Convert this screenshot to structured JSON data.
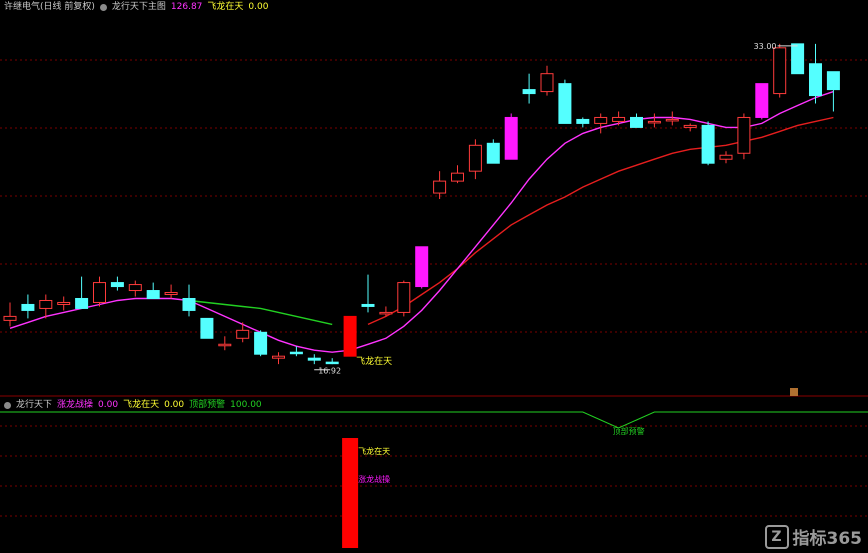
{
  "header": {
    "stock": "许继电气(日线 前复权)",
    "main_name": "龙行天下主图",
    "main_value": "126.87",
    "feilong_label": "飞龙在天",
    "feilong_value": "0.00"
  },
  "indicator_header": {
    "name": "龙行天下",
    "zhanglong_label": "涨龙战操",
    "zhanglong_value": "0.00",
    "feilong_label": "飞龙在天",
    "feilong_value": "0.00",
    "dingbu_label": "顶部预警",
    "dingbu_value": "100.00"
  },
  "annotations": {
    "high": "33.00",
    "low": "16.92",
    "feilong_main": "飞龙在天",
    "feilong_sub": "飞龙在天",
    "zhanglong_sub": "涨龙战操",
    "dingbu_sub": "顶部预警"
  },
  "watermark": {
    "logo": "Z",
    "text": "指标365"
  },
  "colors": {
    "up": "#ff3b3b",
    "up_strong": "#ff19ff",
    "down": "#54ffff",
    "ma_fast": "#ff33ff",
    "ma_slow": "#e61e1e",
    "ma_mid": "#22d022",
    "signal": "#ff0000",
    "grid": "#7a0000",
    "label": "#ffff33"
  },
  "chart_data": {
    "type": "candlestick",
    "price_range": [
      15.5,
      34.5
    ],
    "candles": [
      {
        "o": 19.3,
        "h": 20.0,
        "l": 18.8,
        "c": 19.1,
        "t": "up"
      },
      {
        "o": 19.6,
        "h": 20.4,
        "l": 19.2,
        "c": 19.9,
        "t": "down"
      },
      {
        "o": 19.7,
        "h": 20.4,
        "l": 19.2,
        "c": 20.1,
        "t": "up"
      },
      {
        "o": 19.9,
        "h": 20.3,
        "l": 19.6,
        "c": 20.0,
        "t": "up"
      },
      {
        "o": 20.2,
        "h": 21.3,
        "l": 19.7,
        "c": 19.7,
        "t": "down"
      },
      {
        "o": 20.0,
        "h": 21.3,
        "l": 19.8,
        "c": 21.0,
        "t": "up"
      },
      {
        "o": 21.0,
        "h": 21.3,
        "l": 20.6,
        "c": 20.8,
        "t": "down"
      },
      {
        "o": 20.6,
        "h": 21.1,
        "l": 20.3,
        "c": 20.9,
        "t": "up"
      },
      {
        "o": 20.6,
        "h": 21.0,
        "l": 20.2,
        "c": 20.2,
        "t": "down"
      },
      {
        "o": 20.4,
        "h": 20.9,
        "l": 20.2,
        "c": 20.5,
        "t": "up"
      },
      {
        "o": 20.2,
        "h": 20.9,
        "l": 19.3,
        "c": 19.6,
        "t": "down"
      },
      {
        "o": 19.2,
        "h": 19.2,
        "l": 18.2,
        "c": 18.2,
        "t": "down"
      },
      {
        "o": 17.9,
        "h": 18.3,
        "l": 17.6,
        "c": 17.9,
        "t": "up"
      },
      {
        "o": 18.2,
        "h": 19.0,
        "l": 18.0,
        "c": 18.6,
        "t": "up"
      },
      {
        "o": 18.5,
        "h": 18.6,
        "l": 17.3,
        "c": 17.4,
        "t": "down"
      },
      {
        "o": 17.3,
        "h": 17.5,
        "l": 16.9,
        "c": 17.2,
        "t": "up"
      },
      {
        "o": 17.5,
        "h": 17.8,
        "l": 17.3,
        "c": 17.5,
        "t": "down"
      },
      {
        "o": 17.2,
        "h": 17.4,
        "l": 16.9,
        "c": 17.1,
        "t": "down"
      },
      {
        "o": 17.0,
        "h": 17.2,
        "l": 16.9,
        "c": 17.0,
        "t": "down"
      },
      {
        "o": 17.3,
        "h": 19.3,
        "l": 17.3,
        "c": 19.3,
        "t": "signal"
      },
      {
        "o": 19.9,
        "h": 21.4,
        "l": 19.5,
        "c": 19.8,
        "t": "down"
      },
      {
        "o": 19.5,
        "h": 19.8,
        "l": 19.3,
        "c": 19.5,
        "t": "up"
      },
      {
        "o": 19.5,
        "h": 21.1,
        "l": 19.3,
        "c": 21.0,
        "t": "up"
      },
      {
        "o": 20.8,
        "h": 22.8,
        "l": 20.7,
        "c": 22.8,
        "t": "up_strong"
      },
      {
        "o": 25.5,
        "h": 26.6,
        "l": 25.2,
        "c": 26.1,
        "t": "up"
      },
      {
        "o": 26.1,
        "h": 26.9,
        "l": 26.0,
        "c": 26.5,
        "t": "up"
      },
      {
        "o": 26.6,
        "h": 28.2,
        "l": 26.2,
        "c": 27.9,
        "t": "up"
      },
      {
        "o": 28.0,
        "h": 28.2,
        "l": 27.0,
        "c": 27.0,
        "t": "down"
      },
      {
        "o": 27.2,
        "h": 29.5,
        "l": 27.2,
        "c": 29.3,
        "t": "up_strong"
      },
      {
        "o": 30.7,
        "h": 31.5,
        "l": 30.0,
        "c": 30.5,
        "t": "down"
      },
      {
        "o": 30.6,
        "h": 31.9,
        "l": 30.4,
        "c": 31.5,
        "t": "up"
      },
      {
        "o": 31.0,
        "h": 31.2,
        "l": 29.0,
        "c": 29.0,
        "t": "down"
      },
      {
        "o": 29.2,
        "h": 29.3,
        "l": 28.8,
        "c": 29.0,
        "t": "down"
      },
      {
        "o": 29.0,
        "h": 29.5,
        "l": 28.5,
        "c": 29.3,
        "t": "up"
      },
      {
        "o": 29.3,
        "h": 29.6,
        "l": 28.9,
        "c": 29.1,
        "t": "up"
      },
      {
        "o": 29.3,
        "h": 29.5,
        "l": 28.8,
        "c": 28.8,
        "t": "down"
      },
      {
        "o": 29.1,
        "h": 29.5,
        "l": 28.8,
        "c": 29.1,
        "t": "up"
      },
      {
        "o": 29.2,
        "h": 29.6,
        "l": 28.9,
        "c": 29.2,
        "t": "up"
      },
      {
        "o": 28.8,
        "h": 29.0,
        "l": 28.6,
        "c": 28.9,
        "t": "up"
      },
      {
        "o": 28.9,
        "h": 29.1,
        "l": 26.9,
        "c": 27.0,
        "t": "down"
      },
      {
        "o": 27.2,
        "h": 27.6,
        "l": 27.0,
        "c": 27.4,
        "t": "up"
      },
      {
        "o": 27.5,
        "h": 29.5,
        "l": 27.2,
        "c": 29.3,
        "t": "up"
      },
      {
        "o": 29.3,
        "h": 31.0,
        "l": 29.2,
        "c": 31.0,
        "t": "up_strong"
      },
      {
        "o": 30.5,
        "h": 33.0,
        "l": 30.3,
        "c": 32.8,
        "t": "up"
      },
      {
        "o": 33.0,
        "h": 33.0,
        "l": 31.5,
        "c": 31.5,
        "t": "down"
      },
      {
        "o": 32.0,
        "h": 33.0,
        "l": 30.0,
        "c": 30.4,
        "t": "down"
      },
      {
        "o": 31.6,
        "h": 31.6,
        "l": 29.6,
        "c": 30.7,
        "t": "down"
      }
    ],
    "ma_fast": [
      18.7,
      19.0,
      19.3,
      19.5,
      19.7,
      19.9,
      20.1,
      20.2,
      20.2,
      20.2,
      20.1,
      19.7,
      19.3,
      18.9,
      18.5,
      18.1,
      17.8,
      17.6,
      17.5,
      17.6,
      17.9,
      18.2,
      18.8,
      19.6,
      20.6,
      21.7,
      22.8,
      23.9,
      25.0,
      26.2,
      27.2,
      28.0,
      28.5,
      28.8,
      29.0,
      29.2,
      29.3,
      29.3,
      29.2,
      29.0,
      28.8,
      28.8,
      29.0,
      29.5,
      29.9,
      30.3,
      30.6
    ],
    "ma_slow": [
      null,
      null,
      null,
      null,
      null,
      null,
      null,
      null,
      null,
      null,
      null,
      null,
      null,
      null,
      null,
      null,
      null,
      null,
      null,
      null,
      18.9,
      19.3,
      19.8,
      20.4,
      21.0,
      21.7,
      22.5,
      23.2,
      23.9,
      24.4,
      24.9,
      25.3,
      25.8,
      26.2,
      26.6,
      26.9,
      27.2,
      27.5,
      27.7,
      27.8,
      27.9,
      28.1,
      28.3,
      28.6,
      28.9,
      29.1,
      29.3
    ],
    "ma_mid": [
      null,
      null,
      null,
      null,
      null,
      null,
      null,
      null,
      null,
      null,
      20.1,
      20.0,
      19.9,
      19.8,
      19.7,
      19.5,
      19.3,
      19.1,
      18.9,
      null
    ],
    "high_marker": {
      "index": 44,
      "value": 33.0
    },
    "low_marker": {
      "index": 18,
      "value": 16.92
    },
    "signal_index": 19,
    "indicator": {
      "top_warning": {
        "normal": 100,
        "dip_from": 33,
        "dip_to": 35,
        "dip_value": 0
      },
      "feilong_bar_index": 19
    }
  }
}
